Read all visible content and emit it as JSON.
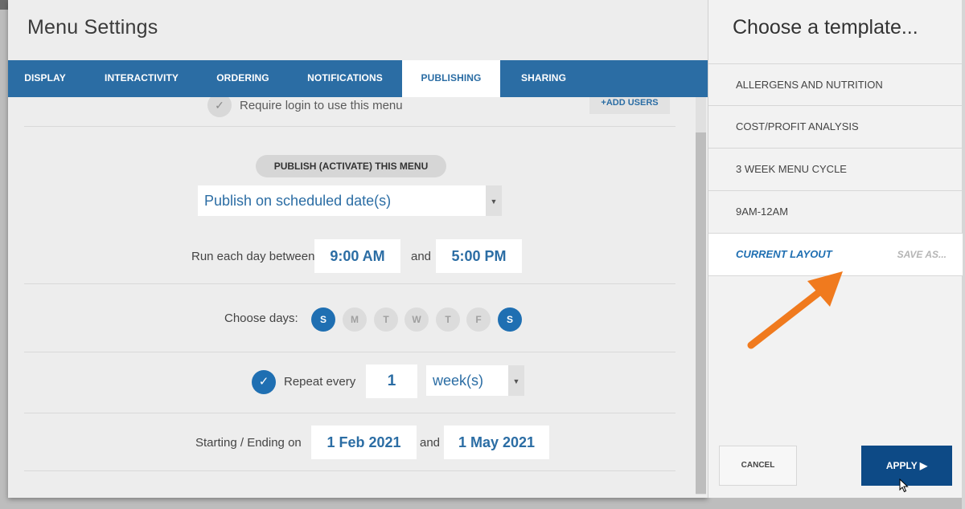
{
  "modal": {
    "title": "Menu Settings",
    "tabs": [
      {
        "label": "DISPLAY"
      },
      {
        "label": "INTERACTIVITY"
      },
      {
        "label": "ORDERING"
      },
      {
        "label": "NOTIFICATIONS"
      },
      {
        "label": "PUBLISHING",
        "active": true
      },
      {
        "label": "SHARING"
      }
    ]
  },
  "publishing": {
    "login_label": "Require login to use this menu",
    "add_users_label": "+ADD USERS",
    "publish_button": "PUBLISH (ACTIVATE) THIS MENU",
    "publish_mode": "Publish on scheduled date(s)",
    "run_label": "Run each day between",
    "start_time": "9:00 AM",
    "and_label": "and",
    "end_time": "5:00 PM",
    "days_label": "Choose days:",
    "days": [
      {
        "letter": "S",
        "selected": true
      },
      {
        "letter": "M",
        "selected": false
      },
      {
        "letter": "T",
        "selected": false
      },
      {
        "letter": "W",
        "selected": false
      },
      {
        "letter": "T",
        "selected": false
      },
      {
        "letter": "F",
        "selected": false
      },
      {
        "letter": "S",
        "selected": true
      }
    ],
    "repeat_label": "Repeat every",
    "repeat_count": "1",
    "repeat_unit": "week(s)",
    "range_label": "Starting / Ending on",
    "start_date": "1 Feb 2021",
    "end_date": "1 May 2021"
  },
  "templates": {
    "title": "Choose a template...",
    "items": [
      {
        "label": "ALLERGENS AND NUTRITION"
      },
      {
        "label": "COST/PROFIT ANALYSIS"
      },
      {
        "label": "3 WEEK MENU CYCLE"
      },
      {
        "label": "9AM-12AM"
      }
    ],
    "current_label": "CURRENT LAYOUT",
    "save_as_label": "SAVE AS...",
    "cancel_label": "CANCEL",
    "apply_label": "APPLY ▶"
  },
  "colors": {
    "primary": "#2b6da4",
    "accent_blue": "#1f6fb2",
    "apply_button": "#0d4a86",
    "annotation_arrow": "#f07a1e"
  }
}
